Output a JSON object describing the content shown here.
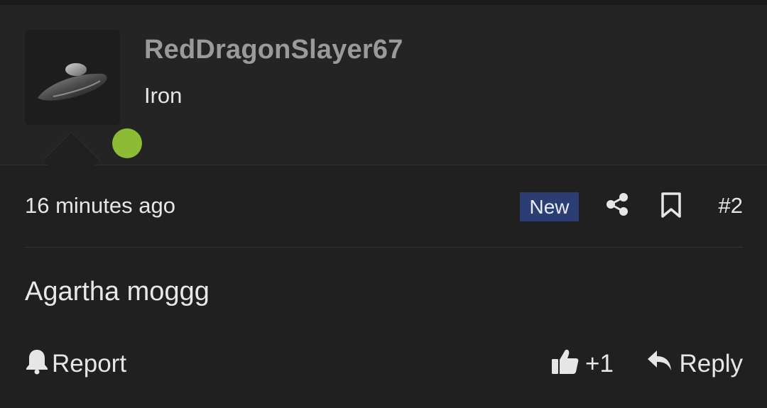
{
  "user": {
    "username": "RedDragonSlayer67",
    "title": "Iron",
    "online": true,
    "online_color": "#8cbc34"
  },
  "post": {
    "timestamp": "16 minutes ago",
    "badge": "New",
    "badge_color": "#2b3d73",
    "number": "#2",
    "message": "Agartha moggg"
  },
  "actions": {
    "report_label": "Report",
    "like_count": "+1",
    "reply_label": "Reply",
    "icons": [
      "bell-icon",
      "thumbs-up-icon",
      "reply-arrow-icon",
      "share-icon",
      "bookmark-icon"
    ]
  }
}
